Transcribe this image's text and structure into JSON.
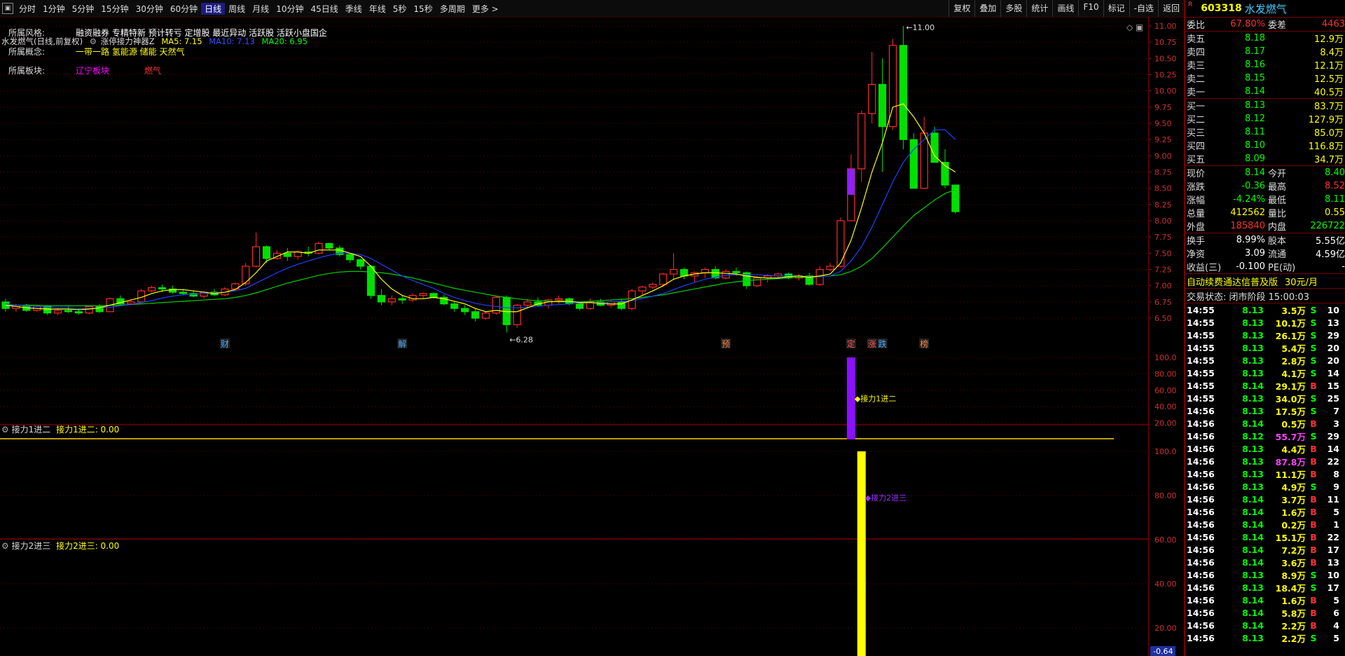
{
  "toolbar": {
    "periods": [
      "分时",
      "1分钟",
      "5分钟",
      "15分钟",
      "30分钟",
      "60分钟",
      "日线",
      "周线",
      "月线",
      "10分钟",
      "45日线",
      "季线",
      "年线",
      "5秒",
      "15秒",
      "多周期",
      "更多 >"
    ],
    "active_period": "日线",
    "right_buttons": [
      "复权",
      "叠加",
      "多股",
      "统计",
      "画线",
      "F10",
      "标记",
      "-自选",
      "返回"
    ]
  },
  "chart_header": {
    "title": "水发燃气(日线,前复权)",
    "indicator": "涨停接力神器Z",
    "ma5": "MA5: 7.15",
    "ma10": "MA10: 7.13",
    "ma20": "MA20: 6.95"
  },
  "stock_tags": [
    {
      "label": "所属风格:",
      "items": [
        {
          "text": "融资融券 专精特新 预计转亏 定增股 最近异动 活跃股 活跃小盘国企",
          "color": "#ffffff"
        }
      ]
    },
    {
      "label": "所属概念:",
      "items": [
        {
          "text": "一带一路 氢能源 储能 天然气",
          "color": "#ffff00"
        }
      ]
    },
    {
      "label": "所属板块:",
      "items": [
        {
          "text": "辽宁板块",
          "color": "#ff00ff"
        },
        {
          "text": "燃气",
          "color": "#ff3030"
        }
      ]
    }
  ],
  "markers": [
    "财",
    "解",
    "预",
    "定",
    "涨",
    "跌",
    "榜"
  ],
  "annotations": {
    "high": "11.00",
    "low": "6.28"
  },
  "panel1": {
    "title": "接力1进二",
    "value": "接力1进二: 0.00",
    "bar_label": "接力1进二"
  },
  "panel2": {
    "title": "接力2进三",
    "value": "接力2进三: 0.00",
    "bar_label": "接力2进三",
    "cursor_value": "-0.64"
  },
  "price_axis": [
    "11.00",
    "10.75",
    "10.50",
    "10.25",
    "10.00",
    "9.75",
    "9.50",
    "9.25",
    "9.00",
    "8.75",
    "8.50",
    "8.25",
    "8.00",
    "7.75",
    "7.50",
    "7.25",
    "7.00",
    "6.75",
    "6.50"
  ],
  "panel_axis": [
    "100.0",
    "80.00",
    "60.00",
    "40.00",
    "20.00"
  ],
  "chart_data": {
    "type": "candlestick",
    "title": "水发燃气(日线,前复权)",
    "ylim": [
      6.28,
      11.0
    ],
    "candles": [
      [
        6.75,
        6.8,
        6.6,
        6.65
      ],
      [
        6.65,
        6.72,
        6.6,
        6.7
      ],
      [
        6.7,
        6.72,
        6.6,
        6.62
      ],
      [
        6.62,
        6.7,
        6.6,
        6.68
      ],
      [
        6.68,
        6.7,
        6.55,
        6.58
      ],
      [
        6.58,
        6.65,
        6.55,
        6.62
      ],
      [
        6.62,
        6.68,
        6.58,
        6.6
      ],
      [
        6.6,
        6.65,
        6.55,
        6.58
      ],
      [
        6.58,
        6.7,
        6.56,
        6.68
      ],
      [
        6.68,
        6.72,
        6.58,
        6.6
      ],
      [
        6.6,
        6.82,
        6.6,
        6.8
      ],
      [
        6.8,
        6.85,
        6.7,
        6.72
      ],
      [
        6.72,
        6.78,
        6.7,
        6.75
      ],
      [
        6.75,
        6.95,
        6.74,
        6.92
      ],
      [
        6.92,
        7.0,
        6.9,
        6.97
      ],
      [
        6.97,
        7.02,
        6.9,
        6.95
      ],
      [
        6.95,
        7.0,
        6.88,
        6.9
      ],
      [
        6.9,
        6.95,
        6.85,
        6.88
      ],
      [
        6.88,
        6.92,
        6.82,
        6.84
      ],
      [
        6.84,
        6.92,
        6.8,
        6.9
      ],
      [
        6.9,
        6.95,
        6.84,
        6.86
      ],
      [
        6.86,
        6.98,
        6.84,
        6.95
      ],
      [
        6.95,
        7.05,
        6.92,
        7.03
      ],
      [
        7.03,
        7.35,
        7.0,
        7.3
      ],
      [
        7.3,
        7.82,
        7.28,
        7.6
      ],
      [
        7.6,
        7.62,
        7.35,
        7.42
      ],
      [
        7.42,
        7.55,
        7.4,
        7.5
      ],
      [
        7.5,
        7.58,
        7.38,
        7.45
      ],
      [
        7.45,
        7.55,
        7.4,
        7.52
      ],
      [
        7.52,
        7.6,
        7.45,
        7.5
      ],
      [
        7.5,
        7.68,
        7.48,
        7.65
      ],
      [
        7.65,
        7.66,
        7.55,
        7.58
      ],
      [
        7.58,
        7.62,
        7.45,
        7.48
      ],
      [
        7.48,
        7.5,
        7.35,
        7.4
      ],
      [
        7.4,
        7.42,
        7.25,
        7.3
      ],
      [
        7.3,
        7.32,
        6.8,
        6.85
      ],
      [
        6.85,
        6.95,
        6.7,
        6.75
      ],
      [
        6.75,
        6.85,
        6.7,
        6.8
      ],
      [
        6.8,
        6.85,
        6.72,
        6.78
      ],
      [
        6.78,
        6.88,
        6.75,
        6.85
      ],
      [
        6.85,
        6.9,
        6.8,
        6.88
      ],
      [
        6.88,
        6.9,
        6.8,
        6.82
      ],
      [
        6.82,
        6.86,
        6.7,
        6.72
      ],
      [
        6.72,
        6.76,
        6.6,
        6.65
      ],
      [
        6.65,
        6.7,
        6.55,
        6.6
      ],
      [
        6.6,
        6.65,
        6.45,
        6.5
      ],
      [
        6.5,
        6.6,
        6.48,
        6.58
      ],
      [
        6.58,
        6.85,
        6.55,
        6.82
      ],
      [
        6.82,
        6.85,
        6.28,
        6.4
      ],
      [
        6.4,
        6.72,
        6.35,
        6.7
      ],
      [
        6.7,
        6.8,
        6.65,
        6.75
      ],
      [
        6.75,
        6.82,
        6.68,
        6.7
      ],
      [
        6.7,
        6.8,
        6.65,
        6.78
      ],
      [
        6.78,
        6.85,
        6.72,
        6.8
      ],
      [
        6.8,
        6.82,
        6.7,
        6.72
      ],
      [
        6.72,
        6.75,
        6.62,
        6.65
      ],
      [
        6.65,
        6.8,
        6.63,
        6.75
      ],
      [
        6.75,
        6.8,
        6.68,
        6.7
      ],
      [
        6.7,
        6.78,
        6.66,
        6.75
      ],
      [
        6.75,
        6.8,
        6.62,
        6.65
      ],
      [
        6.65,
        6.95,
        6.62,
        6.92
      ],
      [
        6.92,
        7.0,
        6.85,
        6.98
      ],
      [
        6.98,
        7.05,
        6.95,
        7.02
      ],
      [
        7.02,
        7.2,
        6.98,
        7.18
      ],
      [
        7.18,
        7.5,
        7.1,
        7.25
      ],
      [
        7.25,
        7.28,
        7.1,
        7.15
      ],
      [
        7.15,
        7.22,
        7.05,
        7.2
      ],
      [
        7.2,
        7.28,
        7.12,
        7.25
      ],
      [
        7.25,
        7.3,
        7.1,
        7.12
      ],
      [
        7.12,
        7.25,
        7.1,
        7.22
      ],
      [
        7.22,
        7.28,
        7.15,
        7.2
      ],
      [
        7.2,
        7.22,
        6.95,
        7.0
      ],
      [
        7.0,
        7.15,
        6.98,
        7.12
      ],
      [
        7.12,
        7.18,
        7.05,
        7.15
      ],
      [
        7.15,
        7.2,
        7.1,
        7.18
      ],
      [
        7.18,
        7.2,
        7.1,
        7.12
      ],
      [
        7.12,
        7.18,
        7.08,
        7.15
      ],
      [
        7.15,
        7.2,
        7.0,
        7.02
      ],
      [
        7.02,
        7.3,
        7.0,
        7.25
      ],
      [
        7.25,
        7.35,
        7.22,
        7.3
      ],
      [
        7.3,
        8.05,
        7.28,
        8.0
      ],
      [
        8.0,
        9.02,
        8.4,
        8.8
      ],
      [
        8.8,
        9.7,
        8.6,
        9.65
      ],
      [
        9.65,
        10.6,
        9.5,
        10.1
      ],
      [
        10.1,
        10.5,
        8.75,
        9.45
      ],
      [
        9.45,
        10.8,
        9.4,
        10.7
      ],
      [
        10.7,
        11.0,
        9.1,
        9.25
      ],
      [
        9.25,
        9.35,
        8.5,
        8.5
      ],
      [
        8.5,
        9.6,
        8.52,
        9.35
      ],
      [
        9.35,
        9.45,
        8.9,
        8.9
      ],
      [
        8.9,
        9.1,
        8.5,
        8.55
      ],
      [
        8.55,
        8.55,
        8.11,
        8.14
      ]
    ],
    "ma5": [
      6.7,
      6.68,
      6.66,
      6.65,
      6.64,
      6.64,
      6.64,
      6.63,
      6.64,
      6.66,
      6.7,
      6.74,
      6.78,
      6.82,
      6.88,
      6.92,
      6.94,
      6.94,
      6.92,
      6.9,
      6.88,
      6.9,
      6.94,
      7.05,
      7.2,
      7.38,
      7.45,
      7.52,
      7.52,
      7.5,
      7.55,
      7.55,
      7.55,
      7.5,
      7.45,
      7.3,
      7.1,
      6.95,
      6.85,
      6.8,
      6.8,
      6.82,
      6.8,
      6.76,
      6.72,
      6.65,
      6.6,
      6.62,
      6.6,
      6.6,
      6.66,
      6.72,
      6.75,
      6.76,
      6.76,
      6.74,
      6.74,
      6.73,
      6.72,
      6.72,
      6.78,
      6.85,
      6.92,
      7.0,
      7.1,
      7.15,
      7.18,
      7.2,
      7.2,
      7.19,
      7.18,
      7.15,
      7.13,
      7.12,
      7.12,
      7.14,
      7.15,
      7.13,
      7.15,
      7.18,
      7.35,
      7.7,
      8.2,
      8.75,
      9.2,
      9.75,
      9.8,
      9.6,
      9.35,
      9.0,
      8.85,
      8.75
    ],
    "ma10": [
      6.72,
      6.7,
      6.69,
      6.68,
      6.67,
      6.66,
      6.66,
      6.65,
      6.65,
      6.66,
      6.67,
      6.69,
      6.71,
      6.74,
      6.77,
      6.81,
      6.84,
      6.86,
      6.87,
      6.88,
      6.89,
      6.9,
      6.92,
      6.96,
      7.04,
      7.12,
      7.2,
      7.27,
      7.33,
      7.38,
      7.43,
      7.47,
      7.5,
      7.5,
      7.48,
      7.42,
      7.33,
      7.24,
      7.15,
      7.08,
      7.02,
      6.96,
      6.88,
      6.82,
      6.77,
      6.73,
      6.7,
      6.68,
      6.66,
      6.66,
      6.67,
      6.68,
      6.7,
      6.71,
      6.72,
      6.73,
      6.74,
      6.74,
      6.75,
      6.76,
      6.77,
      6.8,
      6.84,
      6.88,
      6.94,
      7.0,
      7.05,
      7.1,
      7.13,
      7.16,
      7.17,
      7.17,
      7.17,
      7.16,
      7.15,
      7.15,
      7.15,
      7.14,
      7.14,
      7.15,
      7.22,
      7.38,
      7.6,
      7.9,
      8.25,
      8.6,
      8.9,
      9.1,
      9.25,
      9.4,
      9.4,
      9.25
    ],
    "ma20": [
      6.7,
      6.7,
      6.7,
      6.7,
      6.69,
      6.69,
      6.69,
      6.69,
      6.69,
      6.69,
      6.7,
      6.7,
      6.71,
      6.72,
      6.73,
      6.74,
      6.75,
      6.76,
      6.77,
      6.78,
      6.79,
      6.8,
      6.82,
      6.85,
      6.89,
      6.94,
      6.99,
      7.04,
      7.08,
      7.12,
      7.16,
      7.19,
      7.21,
      7.22,
      7.22,
      7.21,
      7.2,
      7.18,
      7.15,
      7.12,
      7.08,
      7.04,
      7.0,
      6.96,
      6.93,
      6.9,
      6.87,
      6.84,
      6.82,
      6.8,
      6.78,
      6.77,
      6.76,
      6.75,
      6.75,
      6.75,
      6.76,
      6.77,
      6.78,
      6.79,
      6.8,
      6.82,
      6.84,
      6.86,
      6.89,
      6.92,
      6.95,
      6.98,
      7.01,
      7.04,
      7.06,
      7.08,
      7.09,
      7.1,
      7.11,
      7.12,
      7.13,
      7.13,
      7.14,
      7.15,
      7.17,
      7.22,
      7.3,
      7.42,
      7.58,
      7.75,
      7.92,
      8.08,
      8.2,
      8.32,
      8.42,
      8.48
    ],
    "panel1_signal": {
      "index": 81,
      "value": 100
    },
    "panel2_signal": {
      "index": 82,
      "value": 100
    }
  },
  "quote": {
    "code": "603318",
    "name": "水发燃气",
    "weibi_label": "委比",
    "weibi": "67.80%",
    "weicha_label": "委差",
    "weicha": "4463",
    "asks": [
      {
        "label": "卖五",
        "price": "8.18",
        "vol": "12.9万"
      },
      {
        "label": "卖四",
        "price": "8.17",
        "vol": "8.4万"
      },
      {
        "label": "卖三",
        "price": "8.16",
        "vol": "12.1万"
      },
      {
        "label": "卖二",
        "price": "8.15",
        "vol": "12.5万"
      },
      {
        "label": "卖一",
        "price": "8.14",
        "vol": "40.5万"
      }
    ],
    "bids": [
      {
        "label": "买一",
        "price": "8.13",
        "vol": "83.7万"
      },
      {
        "label": "买二",
        "price": "8.12",
        "vol": "127.9万"
      },
      {
        "label": "买三",
        "price": "8.11",
        "vol": "85.0万"
      },
      {
        "label": "买四",
        "price": "8.10",
        "vol": "116.8万"
      },
      {
        "label": "买五",
        "price": "8.09",
        "vol": "34.7万"
      }
    ],
    "stats": [
      {
        "l1": "现价",
        "v1": "8.14",
        "c1": "#00ff00",
        "l2": "今开",
        "v2": "8.40",
        "c2": "#00ff00"
      },
      {
        "l1": "涨跌",
        "v1": "-0.36",
        "c1": "#00ff00",
        "l2": "最高",
        "v2": "8.52",
        "c2": "#ff3030"
      },
      {
        "l1": "涨幅",
        "v1": "-4.24%",
        "c1": "#00ff00",
        "l2": "最低",
        "v2": "8.11",
        "c2": "#00ff00"
      },
      {
        "l1": "总量",
        "v1": "412562",
        "c1": "#ffff00",
        "l2": "量比",
        "v2": "0.55",
        "c2": "#ffff00"
      },
      {
        "l1": "外盘",
        "v1": "185840",
        "c1": "#ff3030",
        "l2": "内盘",
        "v2": "226722",
        "c2": "#00ff00"
      }
    ],
    "stats2": [
      {
        "l1": "换手",
        "v1": "8.99%",
        "l2": "股本",
        "v2": "5.55亿"
      },
      {
        "l1": "净资",
        "v1": "3.09",
        "l2": "流通",
        "v2": "4.59亿"
      },
      {
        "l1": "收益(三)",
        "v1": "-0.100",
        "l2": "PE(动)",
        "v2": "-"
      }
    ],
    "promo": "自动续费通达信普及版",
    "promo_price": "30元/月",
    "trade_state": "交易状态: 闭市阶段 15:00:03",
    "ticks": [
      [
        "14:55",
        "8.13",
        "3.5万",
        "S",
        "10"
      ],
      [
        "14:55",
        "8.13",
        "10.1万",
        "S",
        "13"
      ],
      [
        "14:55",
        "8.13",
        "26.1万",
        "S",
        "29"
      ],
      [
        "14:55",
        "8.13",
        "5.4万",
        "S",
        "20"
      ],
      [
        "14:55",
        "8.13",
        "2.8万",
        "S",
        "20"
      ],
      [
        "14:55",
        "8.13",
        "4.1万",
        "S",
        "14"
      ],
      [
        "14:55",
        "8.14",
        "29.1万",
        "B",
        "15"
      ],
      [
        "14:55",
        "8.13",
        "34.0万",
        "S",
        "25"
      ],
      [
        "14:56",
        "8.13",
        "17.5万",
        "S",
        "7"
      ],
      [
        "14:56",
        "8.14",
        "0.5万",
        "B",
        "3"
      ],
      [
        "14:56",
        "8.12",
        "55.7万",
        "S",
        "29"
      ],
      [
        "14:56",
        "8.13",
        "4.4万",
        "B",
        "14"
      ],
      [
        "14:56",
        "8.13",
        "87.8万",
        "B",
        "22"
      ],
      [
        "14:56",
        "8.13",
        "11.1万",
        "B",
        "8"
      ],
      [
        "14:56",
        "8.13",
        "4.9万",
        "S",
        "9"
      ],
      [
        "14:56",
        "8.14",
        "3.7万",
        "B",
        "11"
      ],
      [
        "14:56",
        "8.14",
        "1.6万",
        "B",
        "5"
      ],
      [
        "14:56",
        "8.14",
        "0.2万",
        "B",
        "1"
      ],
      [
        "14:56",
        "8.14",
        "15.1万",
        "B",
        "22"
      ],
      [
        "14:56",
        "8.14",
        "7.2万",
        "B",
        "17"
      ],
      [
        "14:56",
        "8.14",
        "3.6万",
        "B",
        "13"
      ],
      [
        "14:56",
        "8.13",
        "8.9万",
        "S",
        "10"
      ],
      [
        "14:56",
        "8.13",
        "18.4万",
        "S",
        "17"
      ],
      [
        "14:56",
        "8.14",
        "1.6万",
        "B",
        "5"
      ],
      [
        "14:56",
        "8.14",
        "5.8万",
        "B",
        "6"
      ],
      [
        "14:56",
        "8.14",
        "2.2万",
        "B",
        "4"
      ],
      [
        "14:56",
        "8.13",
        "2.2万",
        "S",
        "5"
      ]
    ]
  }
}
